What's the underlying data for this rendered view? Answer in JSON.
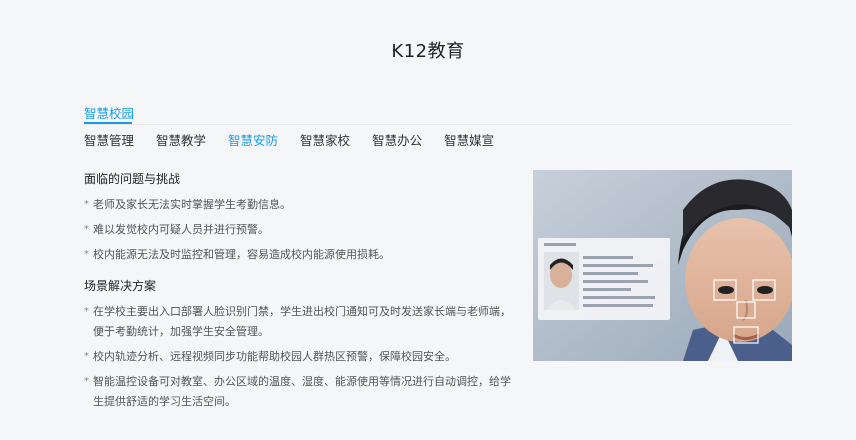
{
  "page": {
    "title": "K12教育"
  },
  "section_tab": {
    "label": "智慧校园"
  },
  "subtabs": [
    {
      "label": "智慧管理",
      "active": false
    },
    {
      "label": "智慧教学",
      "active": false
    },
    {
      "label": "智慧安防",
      "active": true
    },
    {
      "label": "智慧家校",
      "active": false
    },
    {
      "label": "智慧办公",
      "active": false
    },
    {
      "label": "智慧媒宣",
      "active": false
    }
  ],
  "problems": {
    "heading": "面临的问题与挑战",
    "items": [
      "老师及家长无法实时掌握学生考勤信息。",
      "难以发觉校内可疑人员并进行预警。",
      "校内能源无法及时监控和管理，容易造成校内能源使用损耗。"
    ]
  },
  "solutions": {
    "heading": "场景解决方案",
    "items": [
      "在学校主要出入口部署人脸识别门禁，学生进出校门通知可及时发送家长端与老师端，便于考勤统计，加强学生安全管理。",
      "校内轨迹分析、远程视频同步功能帮助校园人群热区预警，保障校园安全。",
      "智能温控设备可对教室、办公区域的温度、湿度、能源使用等情况进行自动调控，给学生提供舒适的学习生活空间。"
    ]
  },
  "colors": {
    "accent": "#1a9be6",
    "background": "#f5f6f8"
  },
  "image": {
    "icon": "face-recognition-photo"
  }
}
